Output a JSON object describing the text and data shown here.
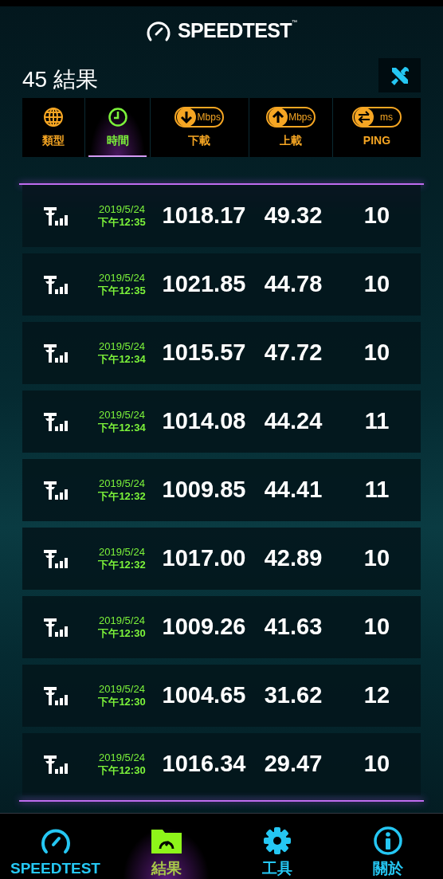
{
  "logo": {
    "text": "SPEEDTEST",
    "mark": "™"
  },
  "header": {
    "title": "45 結果"
  },
  "columns": [
    {
      "kind": "globe",
      "label": "類型",
      "selected": false
    },
    {
      "kind": "clock",
      "label": "時間",
      "selected": true
    },
    {
      "kind": "down",
      "unit": "Mbps",
      "label": "下載",
      "selected": false
    },
    {
      "kind": "up",
      "unit": "Mbps",
      "label": "上載",
      "selected": false
    },
    {
      "kind": "ping",
      "unit": "ms",
      "label": "PING",
      "selected": false
    }
  ],
  "rows": [
    {
      "date": "2019/5/24",
      "time": "下午12:35",
      "download": "1018.17",
      "upload": "49.32",
      "ping": "10"
    },
    {
      "date": "2019/5/24",
      "time": "下午12:35",
      "download": "1021.85",
      "upload": "44.78",
      "ping": "10"
    },
    {
      "date": "2019/5/24",
      "time": "下午12:34",
      "download": "1015.57",
      "upload": "47.72",
      "ping": "10"
    },
    {
      "date": "2019/5/24",
      "time": "下午12:34",
      "download": "1014.08",
      "upload": "44.24",
      "ping": "11"
    },
    {
      "date": "2019/5/24",
      "time": "下午12:32",
      "download": "1009.85",
      "upload": "44.41",
      "ping": "11"
    },
    {
      "date": "2019/5/24",
      "time": "下午12:32",
      "download": "1017.00",
      "upload": "42.89",
      "ping": "10"
    },
    {
      "date": "2019/5/24",
      "time": "下午12:30",
      "download": "1009.26",
      "upload": "41.63",
      "ping": "10"
    },
    {
      "date": "2019/5/24",
      "time": "下午12:30",
      "download": "1004.65",
      "upload": "31.62",
      "ping": "12"
    },
    {
      "date": "2019/5/24",
      "time": "下午12:30",
      "download": "1016.34",
      "upload": "29.47",
      "ping": "10"
    }
  ],
  "nav": [
    {
      "kind": "gauge",
      "label": "SPEEDTEST",
      "selected": false
    },
    {
      "kind": "folder",
      "label": "結果",
      "selected": true
    },
    {
      "kind": "gear",
      "label": "工具",
      "selected": false
    },
    {
      "kind": "info",
      "label": "關於",
      "selected": false
    }
  ]
}
